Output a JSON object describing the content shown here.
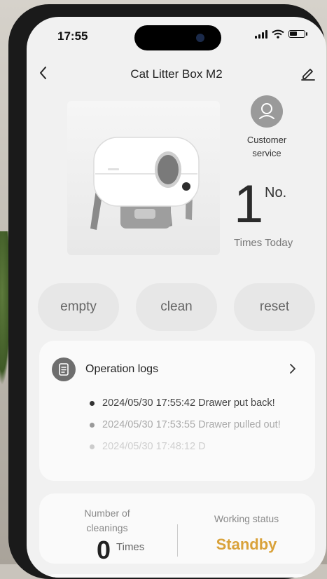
{
  "status_bar": {
    "time": "17:55",
    "battery_level": 0.55
  },
  "nav": {
    "title": "Cat Litter Box M2"
  },
  "customer_service": {
    "label_line1": "Customer",
    "label_line2": "service"
  },
  "today": {
    "count": "1",
    "unit": "No.",
    "label": "Times Today"
  },
  "actions": [
    {
      "label": "empty"
    },
    {
      "label": "clean"
    },
    {
      "label": "reset"
    }
  ],
  "logs": {
    "title": "Operation logs",
    "items": [
      {
        "text": "2024/05/30 17:55:42 Drawer put back!"
      },
      {
        "text": "2024/05/30 17:53:55 Drawer pulled out!"
      },
      {
        "text": "2024/05/30 17:48:12 D"
      }
    ]
  },
  "stats": {
    "cleanings_label_line1": "Number of",
    "cleanings_label_line2": "cleanings",
    "cleanings_value": "0",
    "cleanings_unit": "Times",
    "status_label": "Working status",
    "status_value": "Standby"
  },
  "colors": {
    "status_accent": "#d9a23a",
    "screen_bg": "#f1f1f1",
    "card_bg": "#fafafa"
  },
  "icons": {
    "back": "chevron-left-icon",
    "edit": "pencil-icon",
    "customer_service": "headset-icon",
    "logs": "document-list-icon",
    "logs_more": "chevron-right-icon"
  }
}
